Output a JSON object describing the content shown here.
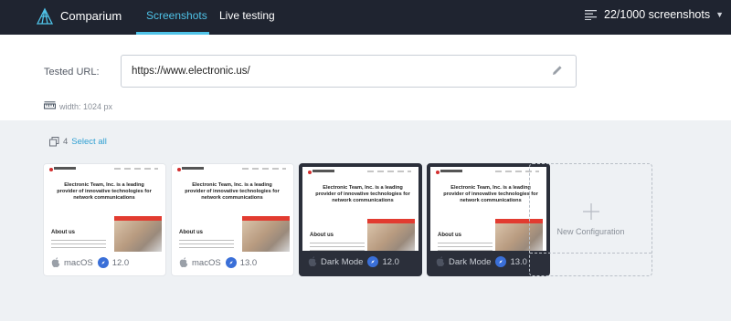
{
  "app": {
    "brand": "Comparium",
    "logo_icon": "comparium-logo-icon"
  },
  "nav": {
    "tabs": [
      {
        "label": "Screenshots",
        "active": true
      },
      {
        "label": "Live testing",
        "active": false
      }
    ],
    "quota": "22/1000 screenshots",
    "quota_icon": "list-icon"
  },
  "url_panel": {
    "label": "Tested URL:",
    "url": "https://www.electronic.us/",
    "width_text": "width: 1024 px"
  },
  "selection": {
    "count": "4",
    "select_all": "Select all"
  },
  "thumbnail": {
    "headline": "Electronic Team, Inc. is a leading provider of innovative technologies for network communications",
    "about": "About us"
  },
  "cards": [
    {
      "theme": "light",
      "os": "macOS",
      "os_icon": "apple-icon",
      "version": "12.0",
      "browser_icon": "safari-icon"
    },
    {
      "theme": "light",
      "os": "macOS",
      "os_icon": "apple-icon",
      "version": "13.0",
      "browser_icon": "safari-icon"
    },
    {
      "theme": "dark",
      "os": "Dark Mode",
      "os_icon": "apple-icon",
      "version": "12.0",
      "browser_icon": "safari-icon"
    },
    {
      "theme": "dark",
      "os": "Dark Mode",
      "os_icon": "apple-icon",
      "version": "13.0",
      "browser_icon": "safari-icon"
    }
  ],
  "new_config": {
    "label": "New Configuration"
  },
  "colors": {
    "topbar": "#1f2430",
    "accent": "#4fc3e8",
    "link": "#2f9fd2",
    "badge": "#3a6fd8"
  }
}
